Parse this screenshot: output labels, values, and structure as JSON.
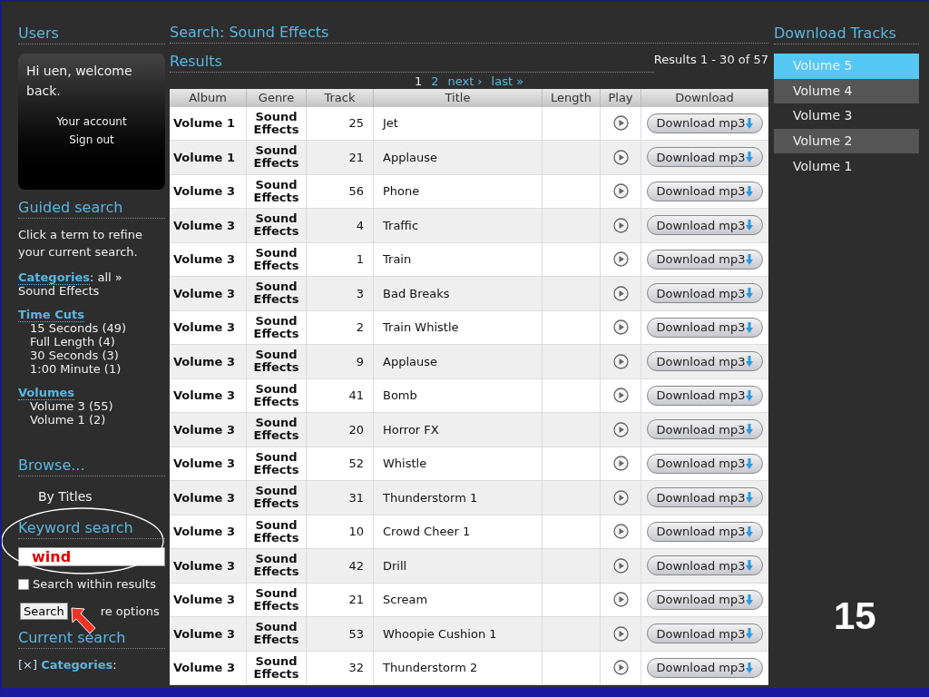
{
  "sidebar": {
    "users": {
      "title": "Users",
      "greeting": "Hi uen, welcome back.",
      "links": [
        "Your account",
        "Sign out"
      ]
    },
    "guided": {
      "title": "Guided search",
      "hint": "Click a term to refine your current search.",
      "facets": [
        {
          "label": "Categories",
          "suffix": ": all »",
          "items": [
            "Sound Effects"
          ],
          "kind": "inline"
        },
        {
          "label": "Time Cuts",
          "items": [
            "15 Seconds (49)",
            "Full Length (4)",
            "30 Seconds (3)",
            "1:00 Minute (1)"
          ],
          "kind": "list"
        },
        {
          "label": "Volumes",
          "items": [
            "Volume 3 (55)",
            "Volume 1 (2)"
          ],
          "kind": "list"
        }
      ]
    },
    "browse": {
      "title": "Browse...",
      "items": [
        "By Titles"
      ]
    },
    "keyword": {
      "title": "Keyword search",
      "value": "wind",
      "within": {
        "label": "Search within results",
        "checked": false
      },
      "button": "Search",
      "more": "re options"
    },
    "current": {
      "title": "Current search",
      "remove": "[×]",
      "label": "Categories",
      "suffix": ":"
    }
  },
  "main": {
    "title": "Search: Sound Effects",
    "results_title": "Results",
    "count": "Results 1 - 30 of 57",
    "pages": [
      {
        "label": "1",
        "selected": true
      },
      {
        "label": "2",
        "selected": false
      },
      {
        "label": "next ›",
        "selected": false
      },
      {
        "label": "last »",
        "selected": false
      }
    ],
    "columns": [
      "Album",
      "Genre",
      "Track",
      "Title",
      "Length",
      "Play",
      "Download"
    ],
    "rows": [
      {
        "album": "Volume 1",
        "genre": "Sound Effects",
        "track": "25",
        "title": "Jet",
        "download": "Download mp3"
      },
      {
        "album": "Volume 1",
        "genre": "Sound Effects",
        "track": "21",
        "title": "Applause",
        "download": "Download mp3"
      },
      {
        "album": "Volume 3",
        "genre": "Sound Effects",
        "track": "56",
        "title": "Phone",
        "download": "Download mp3"
      },
      {
        "album": "Volume 3",
        "genre": "Sound Effects",
        "track": "4",
        "title": "Traffic",
        "download": "Download mp3"
      },
      {
        "album": "Volume 3",
        "genre": "Sound Effects",
        "track": "1",
        "title": "Train",
        "download": "Download mp3"
      },
      {
        "album": "Volume 3",
        "genre": "Sound Effects",
        "track": "3",
        "title": "Bad Breaks",
        "download": "Download mp3"
      },
      {
        "album": "Volume 3",
        "genre": "Sound Effects",
        "track": "2",
        "title": "Train Whistle",
        "download": "Download mp3"
      },
      {
        "album": "Volume 3",
        "genre": "Sound Effects",
        "track": "9",
        "title": "Applause",
        "download": "Download mp3"
      },
      {
        "album": "Volume 3",
        "genre": "Sound Effects",
        "track": "41",
        "title": "Bomb",
        "download": "Download mp3"
      },
      {
        "album": "Volume 3",
        "genre": "Sound Effects",
        "track": "20",
        "title": "Horror FX",
        "download": "Download mp3"
      },
      {
        "album": "Volume 3",
        "genre": "Sound Effects",
        "track": "52",
        "title": "Whistle",
        "download": "Download mp3"
      },
      {
        "album": "Volume 3",
        "genre": "Sound Effects",
        "track": "31",
        "title": "Thunderstorm 1",
        "download": "Download mp3"
      },
      {
        "album": "Volume 3",
        "genre": "Sound Effects",
        "track": "10",
        "title": "Crowd Cheer 1",
        "download": "Download mp3"
      },
      {
        "album": "Volume 3",
        "genre": "Sound Effects",
        "track": "42",
        "title": "Drill",
        "download": "Download mp3"
      },
      {
        "album": "Volume 3",
        "genre": "Sound Effects",
        "track": "21",
        "title": "Scream",
        "download": "Download mp3"
      },
      {
        "album": "Volume 3",
        "genre": "Sound Effects",
        "track": "53",
        "title": "Whoopie Cushion 1",
        "download": "Download mp3"
      },
      {
        "album": "Volume 3",
        "genre": "Sound Effects",
        "track": "32",
        "title": "Thunderstorm 2",
        "download": "Download mp3"
      }
    ]
  },
  "downloads": {
    "title": "Download Tracks",
    "items": [
      {
        "label": "Volume 5",
        "selected": true
      },
      {
        "label": "Volume 4",
        "selected": false
      },
      {
        "label": "Volume 3",
        "selected": false
      },
      {
        "label": "Volume 2",
        "selected": false
      },
      {
        "label": "Volume 1",
        "selected": false
      }
    ]
  },
  "slide_number": "15"
}
